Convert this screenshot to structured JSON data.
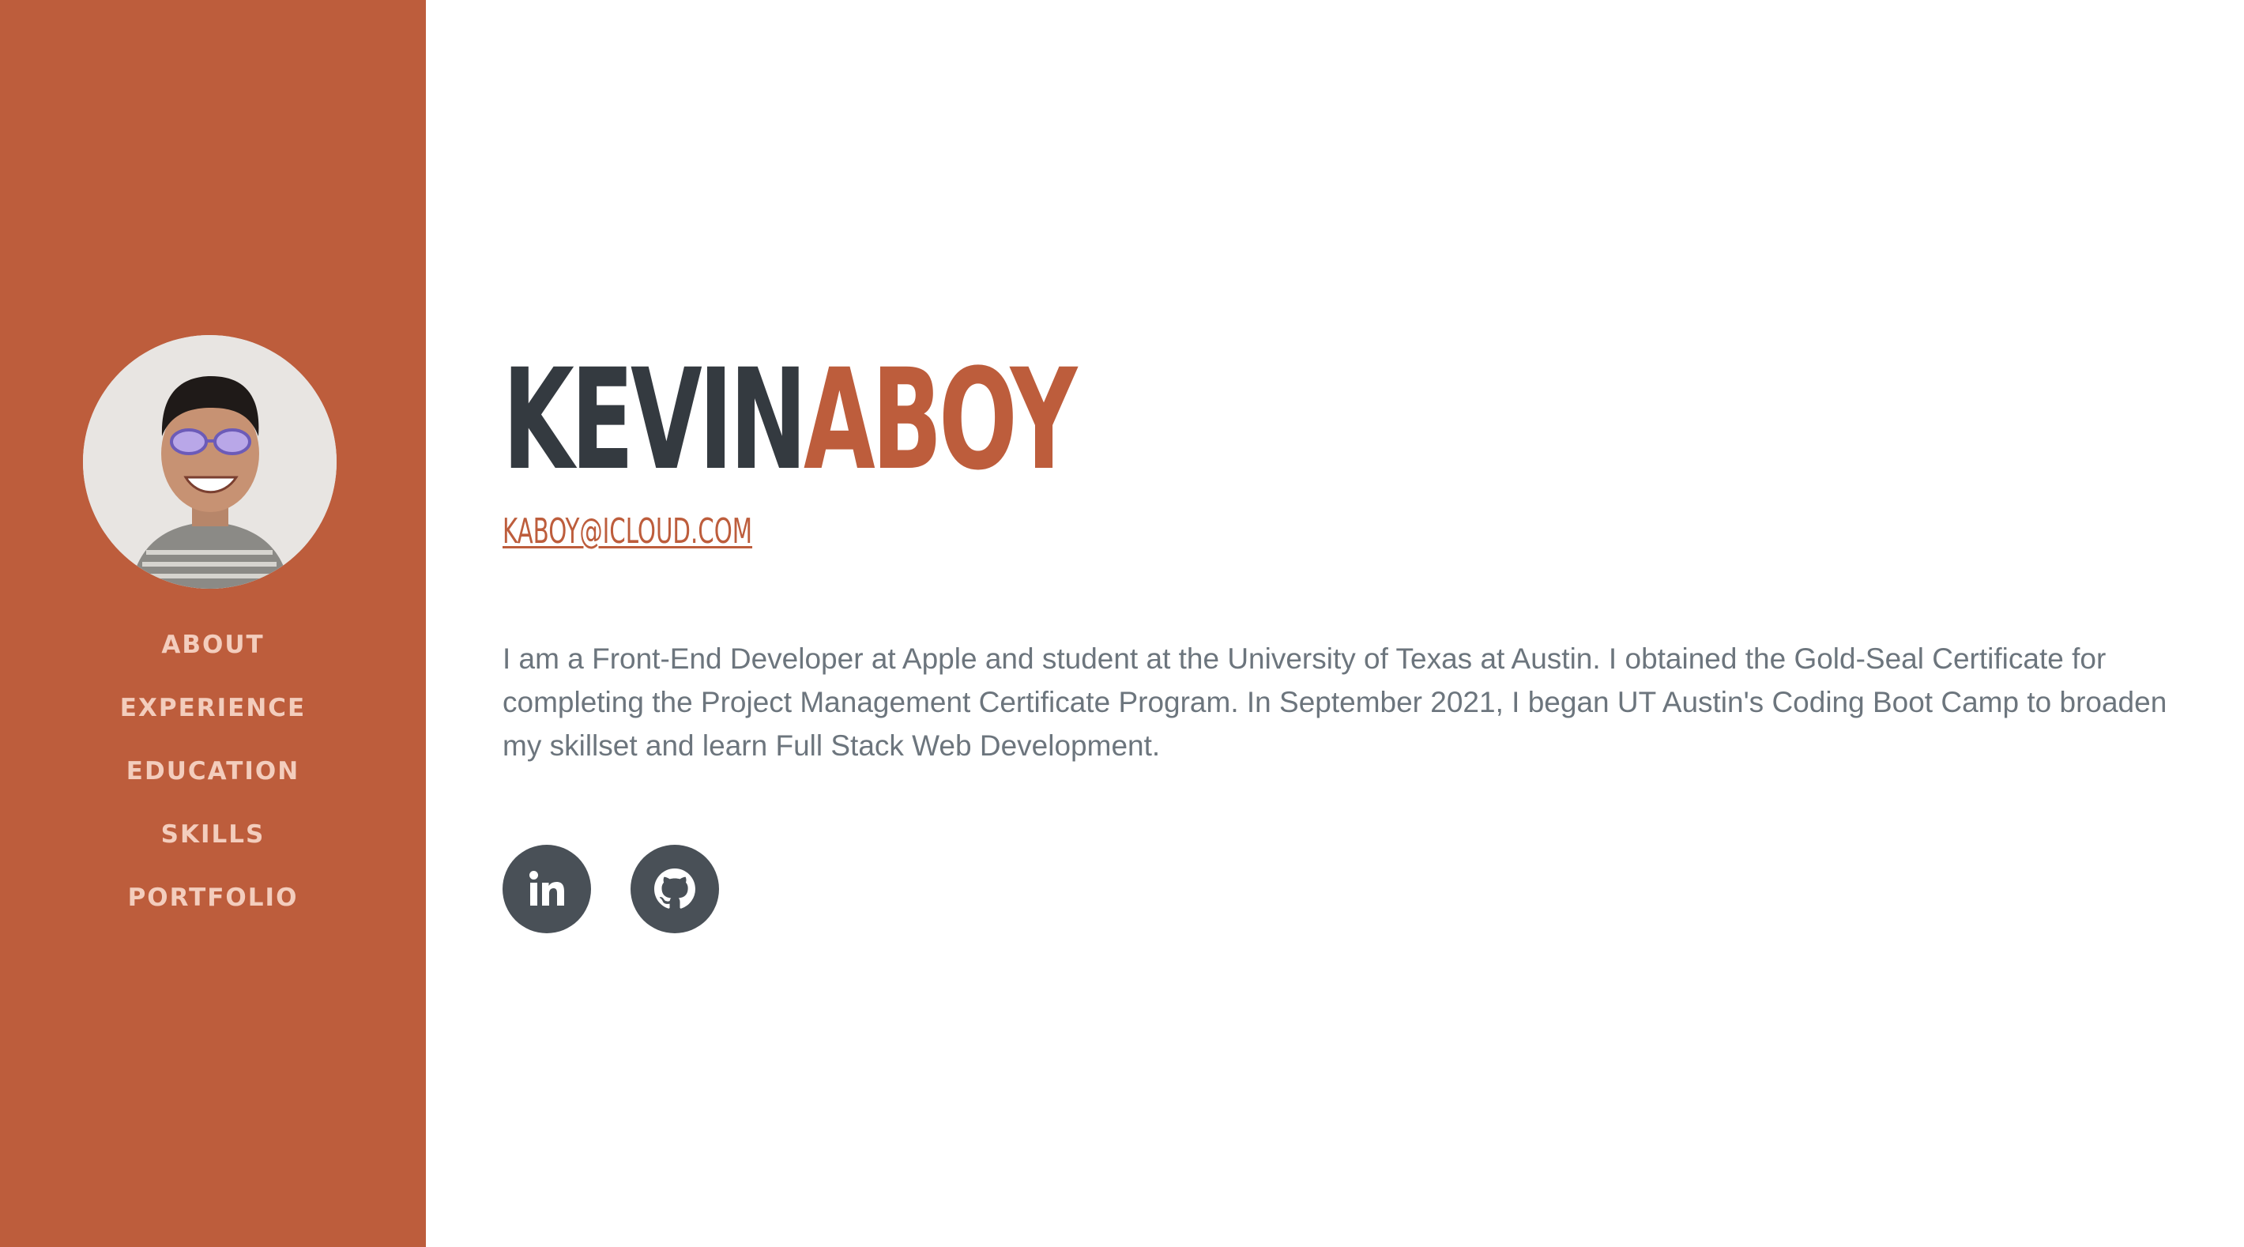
{
  "colors": {
    "sidebar_bg": "#bd5d3c",
    "accent": "#bd5d3c",
    "heading_dark": "#343a40",
    "body_text": "#6c757d",
    "social_bg": "#495057",
    "nav_text": "#f3cdbd"
  },
  "sidebar": {
    "nav": [
      {
        "label": "ABOUT"
      },
      {
        "label": "EXPERIENCE"
      },
      {
        "label": "EDUCATION"
      },
      {
        "label": "SKILLS"
      },
      {
        "label": "PORTFOLIO"
      }
    ]
  },
  "about": {
    "first_name": "KEVIN",
    "last_name": "ABOY",
    "email": "KABOY@ICLOUD.COM",
    "bio": "I am a Front-End Developer at Apple and student at the University of Texas at Austin. I obtained the Gold-Seal Certificate for completing the Project Management Certificate Program. In September 2021, I began UT Austin's Coding Boot Camp to broaden my skillset and learn Full Stack Web Development."
  },
  "social": [
    {
      "icon": "linkedin-icon"
    },
    {
      "icon": "github-icon"
    }
  ]
}
